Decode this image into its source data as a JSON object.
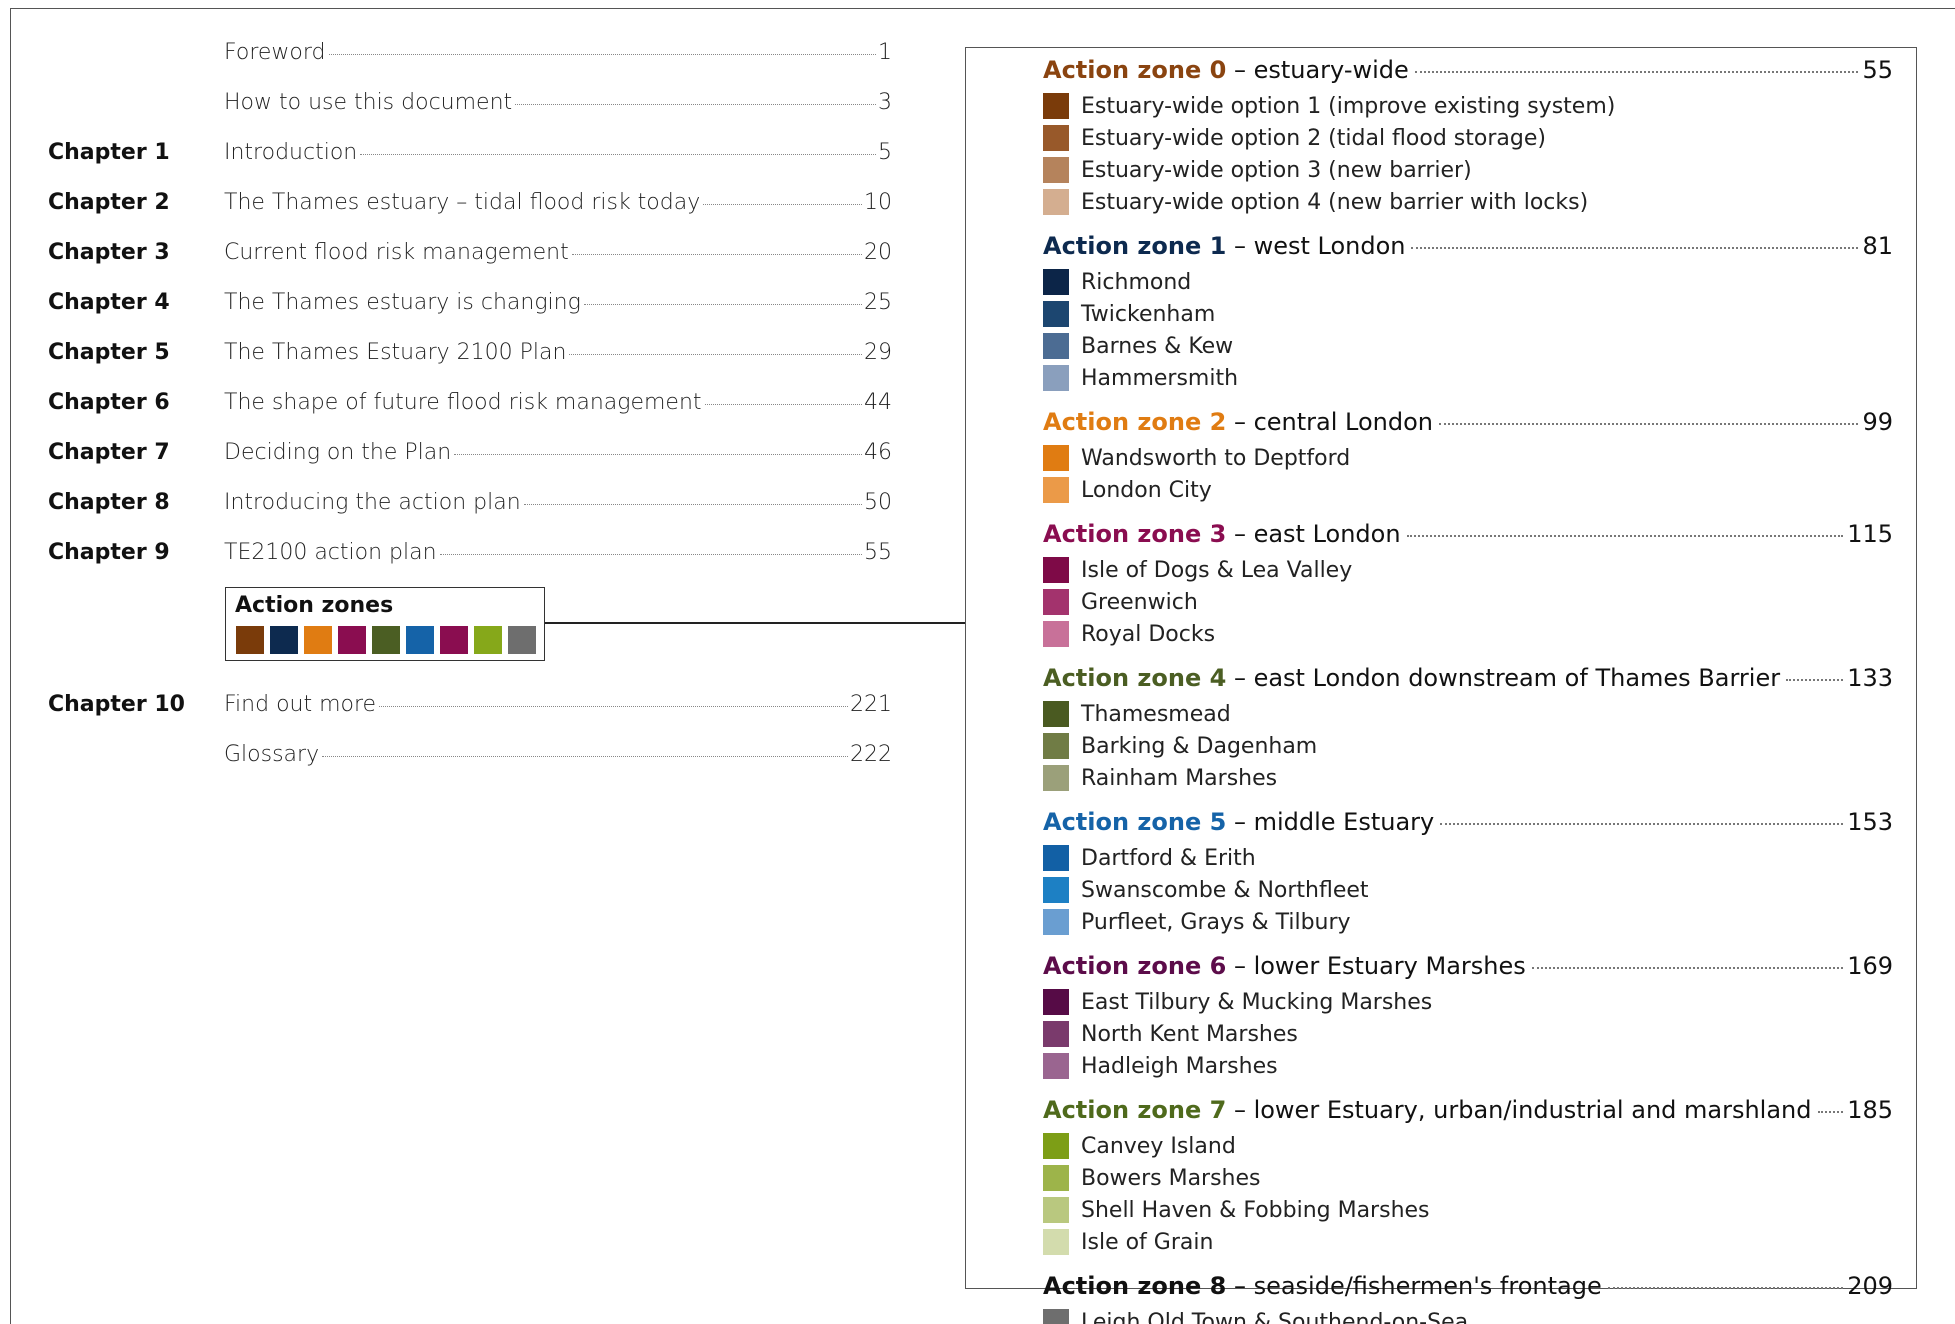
{
  "contents": [
    {
      "chapter": "",
      "title": "Foreword",
      "page": "1"
    },
    {
      "chapter": "",
      "title": "How to use this document",
      "page": "3"
    },
    {
      "chapter": "Chapter 1",
      "title": "Introduction",
      "page": "5"
    },
    {
      "chapter": "Chapter 2",
      "title": "The Thames estuary – tidal flood risk today",
      "page": "10"
    },
    {
      "chapter": "Chapter 3",
      "title": "Current flood risk management",
      "page": "20"
    },
    {
      "chapter": "Chapter 4",
      "title": "The Thames estuary is changing",
      "page": "25"
    },
    {
      "chapter": "Chapter 5",
      "title": "The Thames Estuary 2100 Plan",
      "page": "29"
    },
    {
      "chapter": "Chapter 6",
      "title": "The shape of future flood risk management",
      "page": "44"
    },
    {
      "chapter": "Chapter 7",
      "title": "Deciding on the Plan",
      "page": "46"
    },
    {
      "chapter": "Chapter 8",
      "title": "Introducing the action plan",
      "page": "50"
    },
    {
      "chapter": "Chapter 9",
      "title": "TE2100 action plan",
      "page": "55"
    },
    {
      "chapter": "Chapter 10",
      "title": "Find out more",
      "page": "221"
    },
    {
      "chapter": "",
      "title": "Glossary",
      "page": "222"
    }
  ],
  "action_zones_box": {
    "title": "Action zones",
    "swatches": [
      "#7a3b0a",
      "#0d2a4f",
      "#e07c12",
      "#8a0d50",
      "#4b5e23",
      "#1563a8",
      "#8a0d50",
      "#86a81a",
      "#6e6e6e"
    ]
  },
  "zones": [
    {
      "label": "Action zone 0",
      "desc": "– estuary-wide",
      "page": "55",
      "color": "#8a4410",
      "items": [
        {
          "name": "Estuary-wide option 1 (improve existing system)",
          "color": "#7a3b0a"
        },
        {
          "name": "Estuary-wide option 2 (tidal flood storage)",
          "color": "#98592a"
        },
        {
          "name": "Estuary-wide option 3 (new barrier)",
          "color": "#b5835c"
        },
        {
          "name": "Estuary-wide option 4 (new barrier with locks)",
          "color": "#d4ae90"
        }
      ]
    },
    {
      "label": "Action zone 1",
      "desc": "– west London",
      "page": "81",
      "color": "#0d2a4f",
      "items": [
        {
          "name": "Richmond",
          "color": "#0c2548"
        },
        {
          "name": "Twickenham",
          "color": "#1c4670"
        },
        {
          "name": "Barnes & Kew",
          "color": "#4c6c93"
        },
        {
          "name": "Hammersmith",
          "color": "#8a9fbd"
        }
      ]
    },
    {
      "label": "Action zone 2",
      "desc": "– central London",
      "page": "99",
      "color": "#e07c12",
      "items": [
        {
          "name": "Wandsworth to Deptford",
          "color": "#e07c12"
        },
        {
          "name": "London City",
          "color": "#eb9a48"
        }
      ]
    },
    {
      "label": "Action zone 3",
      "desc": "– east London",
      "page": "115",
      "color": "#8a0d50",
      "items": [
        {
          "name": "Isle of Dogs & Lea Valley",
          "color": "#7e0a47"
        },
        {
          "name": "Greenwich",
          "color": "#a3336d"
        },
        {
          "name": "Royal Docks",
          "color": "#c87199"
        }
      ]
    },
    {
      "label": "Action zone 4",
      "desc": "– east London downstream of Thames Barrier",
      "page": "133",
      "color": "#4b5e23",
      "items": [
        {
          "name": "Thamesmead",
          "color": "#4a5a21"
        },
        {
          "name": "Barking & Dagenham",
          "color": "#707c45"
        },
        {
          "name": "Rainham Marshes",
          "color": "#9ba07a"
        }
      ]
    },
    {
      "label": "Action zone 5",
      "desc": "– middle Estuary",
      "page": "153",
      "color": "#1563a8",
      "items": [
        {
          "name": "Dartford & Erith",
          "color": "#1260a5"
        },
        {
          "name": "Swanscombe & Northfleet",
          "color": "#1d80c4"
        },
        {
          "name": "Purfleet, Grays & Tilbury",
          "color": "#6a9ed1"
        }
      ]
    },
    {
      "label": "Action zone 6",
      "desc": "– lower Estuary Marshes",
      "page": "169",
      "color": "#5c0c4a",
      "items": [
        {
          "name": "East Tilbury & Mucking Marshes",
          "color": "#560b46"
        },
        {
          "name": "North Kent Marshes",
          "color": "#7a3a6c"
        },
        {
          "name": "Hadleigh Marshes",
          "color": "#9a6590"
        }
      ]
    },
    {
      "label": "Action zone 7",
      "desc": "– lower Estuary, urban/industrial and marshland",
      "page": "185",
      "color": "#4f6a1c",
      "items": [
        {
          "name": "Canvey Island",
          "color": "#7d9e16"
        },
        {
          "name": "Bowers Marshes",
          "color": "#9db44a"
        },
        {
          "name": "Shell Haven & Fobbing Marshes",
          "color": "#b9c87f"
        },
        {
          "name": "Isle of Grain",
          "color": "#d3dcad"
        }
      ]
    },
    {
      "label": "Action zone 8",
      "desc": "– seaside/fishermen's frontage",
      "page": "209",
      "color": "#111111",
      "items": [
        {
          "name": "Leigh Old Town & Southend-on-Sea",
          "color": "#6e6e6e"
        }
      ]
    }
  ]
}
